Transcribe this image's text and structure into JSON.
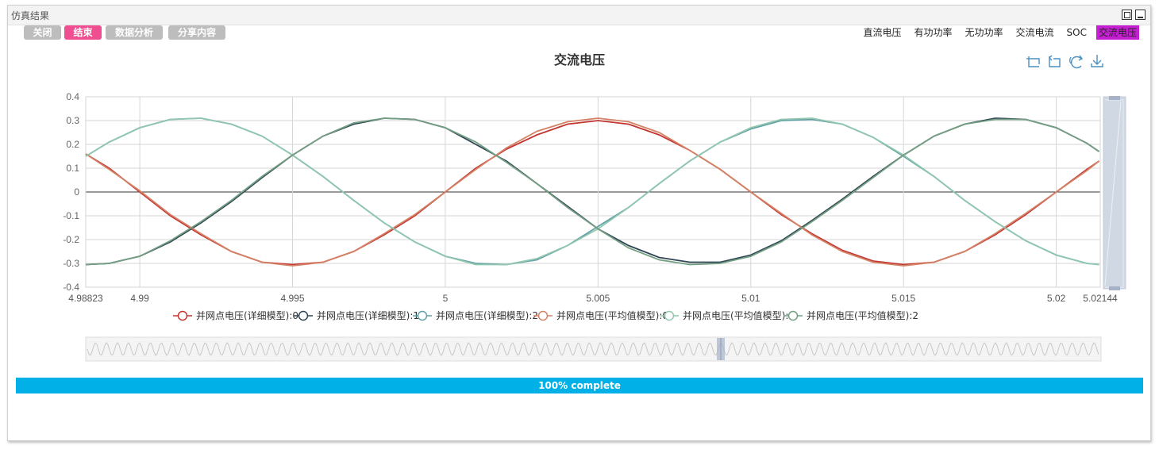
{
  "window": {
    "title": "仿真结果"
  },
  "toolbar": {
    "close_label": "关闭",
    "end_label": "结束",
    "analysis_label": "数据分析",
    "share_label": "分享内容"
  },
  "tabs": [
    {
      "label": "直流电压"
    },
    {
      "label": "有功功率"
    },
    {
      "label": "无功功率"
    },
    {
      "label": "交流电流"
    },
    {
      "label": "SOC"
    },
    {
      "label": "交流电压"
    }
  ],
  "active_tab_color": "#c41fd0",
  "chart_tools": [
    "zoom-in-icon",
    "zoom-reset-icon",
    "refresh-icon",
    "download-icon"
  ],
  "progress": {
    "label": "100% complete",
    "value": 1.0,
    "color": "#00b0e7"
  },
  "chart_data": {
    "type": "line",
    "title": "交流电压",
    "xlim": [
      4.98823,
      5.02144
    ],
    "ylim": [
      -0.4,
      0.4
    ],
    "xticks": [
      "4.98823",
      "4.99",
      "4.995",
      "5",
      "5.005",
      "5.01",
      "5.015",
      "5.02",
      "5.02144"
    ],
    "xtick_values": [
      4.98823,
      4.99,
      4.995,
      5,
      5.005,
      5.01,
      5.015,
      5.02,
      5.02144
    ],
    "yticks": [
      "0.4",
      "0.3",
      "0.2",
      "0.1",
      "0",
      "-0.1",
      "-0.2",
      "-0.3",
      "-0.4"
    ],
    "ytick_values": [
      0.4,
      0.3,
      0.2,
      0.1,
      0,
      -0.1,
      -0.2,
      -0.3,
      -0.4
    ],
    "grid": true,
    "legend_position": "bottom",
    "series": [
      {
        "name": "并网点电压(详细模型):0",
        "color": "#c23531",
        "x": [
          4.988,
          4.989,
          4.99,
          4.991,
          4.992,
          4.993,
          4.994,
          4.995,
          4.996,
          4.997,
          4.998,
          4.999,
          5.0,
          5.001,
          5.002,
          5.003,
          5.004,
          5.005,
          5.006,
          5.007,
          5.008,
          5.009,
          5.01,
          5.011,
          5.012,
          5.013,
          5.014,
          5.015,
          5.016,
          5.017,
          5.018,
          5.019,
          5.02,
          5.021,
          5.0214
        ],
        "y": [
          0.16,
          0.1,
          0.0,
          -0.1,
          -0.18,
          -0.25,
          -0.295,
          -0.305,
          -0.295,
          -0.25,
          -0.18,
          -0.1,
          0.0,
          0.1,
          0.18,
          0.24,
          0.285,
          0.3,
          0.285,
          0.24,
          0.175,
          0.095,
          0.0,
          -0.095,
          -0.175,
          -0.245,
          -0.29,
          -0.305,
          -0.295,
          -0.25,
          -0.18,
          -0.095,
          0.0,
          0.095,
          0.13
        ]
      },
      {
        "name": "并网点电压(详细模型):1",
        "color": "#2f4554",
        "x": [
          4.988,
          4.989,
          4.99,
          4.991,
          4.992,
          4.993,
          4.994,
          4.995,
          4.996,
          4.997,
          4.998,
          4.999,
          5.0,
          5.001,
          5.002,
          5.003,
          5.004,
          5.005,
          5.006,
          5.007,
          5.008,
          5.009,
          5.01,
          5.011,
          5.012,
          5.013,
          5.014,
          5.015,
          5.016,
          5.017,
          5.018,
          5.019,
          5.02,
          5.021,
          5.0214
        ],
        "y": [
          -0.305,
          -0.3,
          -0.27,
          -0.21,
          -0.13,
          -0.04,
          0.06,
          0.155,
          0.235,
          0.285,
          0.31,
          0.305,
          0.27,
          0.2,
          0.13,
          0.035,
          -0.06,
          -0.155,
          -0.225,
          -0.275,
          -0.295,
          -0.295,
          -0.265,
          -0.205,
          -0.12,
          -0.03,
          0.065,
          0.155,
          0.235,
          0.285,
          0.31,
          0.305,
          0.27,
          0.205,
          0.17
        ]
      },
      {
        "name": "并网点电压(详细模型):2",
        "color": "#61a0a8",
        "x": [
          4.988,
          4.989,
          4.99,
          4.991,
          4.992,
          4.993,
          4.994,
          4.995,
          4.996,
          4.997,
          4.998,
          4.999,
          5.0,
          5.001,
          5.002,
          5.003,
          5.004,
          5.005,
          5.006,
          5.007,
          5.008,
          5.009,
          5.01,
          5.011,
          5.012,
          5.013,
          5.014,
          5.015,
          5.016,
          5.017,
          5.018,
          5.019,
          5.02,
          5.021,
          5.0214
        ],
        "y": [
          0.15,
          0.21,
          0.27,
          0.305,
          0.31,
          0.285,
          0.235,
          0.155,
          0.065,
          -0.035,
          -0.13,
          -0.21,
          -0.27,
          -0.3,
          -0.305,
          -0.285,
          -0.225,
          -0.145,
          -0.065,
          0.035,
          0.13,
          0.21,
          0.265,
          0.3,
          0.305,
          0.285,
          0.23,
          0.15,
          0.065,
          -0.035,
          -0.125,
          -0.205,
          -0.265,
          -0.3,
          -0.305
        ]
      },
      {
        "name": "并网点电压(平均值模型):0",
        "color": "#d48265",
        "x": [
          4.988,
          4.989,
          4.99,
          4.991,
          4.992,
          4.993,
          4.994,
          4.995,
          4.996,
          4.997,
          4.998,
          4.999,
          5.0,
          5.001,
          5.002,
          5.003,
          5.004,
          5.005,
          5.006,
          5.007,
          5.008,
          5.009,
          5.01,
          5.011,
          5.012,
          5.013,
          5.014,
          5.015,
          5.016,
          5.017,
          5.018,
          5.019,
          5.02,
          5.021,
          5.0214
        ],
        "y": [
          0.16,
          0.095,
          0.005,
          -0.095,
          -0.175,
          -0.25,
          -0.295,
          -0.31,
          -0.295,
          -0.25,
          -0.175,
          -0.095,
          0.0,
          0.095,
          0.185,
          0.255,
          0.295,
          0.31,
          0.295,
          0.25,
          0.175,
          0.095,
          0.0,
          -0.09,
          -0.18,
          -0.25,
          -0.295,
          -0.31,
          -0.295,
          -0.25,
          -0.175,
          -0.09,
          0.0,
          0.09,
          0.13
        ]
      },
      {
        "name": "并网点电压(平均值模型):1",
        "color": "#91c7ae",
        "x": [
          4.988,
          4.989,
          4.99,
          4.991,
          4.992,
          4.993,
          4.994,
          4.995,
          4.996,
          4.997,
          4.998,
          4.999,
          5.0,
          5.001,
          5.002,
          5.003,
          5.004,
          5.005,
          5.006,
          5.007,
          5.008,
          5.009,
          5.01,
          5.011,
          5.012,
          5.013,
          5.014,
          5.015,
          5.016,
          5.017,
          5.018,
          5.019,
          5.02,
          5.021,
          5.0214
        ],
        "y": [
          0.15,
          0.21,
          0.27,
          0.305,
          0.31,
          0.285,
          0.235,
          0.155,
          0.065,
          -0.035,
          -0.13,
          -0.21,
          -0.27,
          -0.305,
          -0.305,
          -0.28,
          -0.225,
          -0.155,
          -0.065,
          0.035,
          0.13,
          0.21,
          0.27,
          0.305,
          0.31,
          0.285,
          0.23,
          0.155,
          0.065,
          -0.035,
          -0.125,
          -0.205,
          -0.265,
          -0.3,
          -0.305
        ]
      },
      {
        "name": "并网点电压(平均值模型):2",
        "color": "#749f83",
        "x": [
          4.988,
          4.989,
          4.99,
          4.991,
          4.992,
          4.993,
          4.994,
          4.995,
          4.996,
          4.997,
          4.998,
          4.999,
          5.0,
          5.001,
          5.002,
          5.003,
          5.004,
          5.005,
          5.006,
          5.007,
          5.008,
          5.009,
          5.01,
          5.011,
          5.012,
          5.013,
          5.014,
          5.015,
          5.016,
          5.017,
          5.018,
          5.019,
          5.02,
          5.021,
          5.0214
        ],
        "y": [
          -0.305,
          -0.3,
          -0.27,
          -0.205,
          -0.125,
          -0.035,
          0.065,
          0.155,
          0.235,
          0.29,
          0.31,
          0.305,
          0.27,
          0.21,
          0.125,
          0.035,
          -0.065,
          -0.155,
          -0.235,
          -0.285,
          -0.305,
          -0.3,
          -0.27,
          -0.21,
          -0.125,
          -0.035,
          0.06,
          0.155,
          0.235,
          0.285,
          0.305,
          0.305,
          0.27,
          0.205,
          0.17
        ]
      }
    ]
  }
}
